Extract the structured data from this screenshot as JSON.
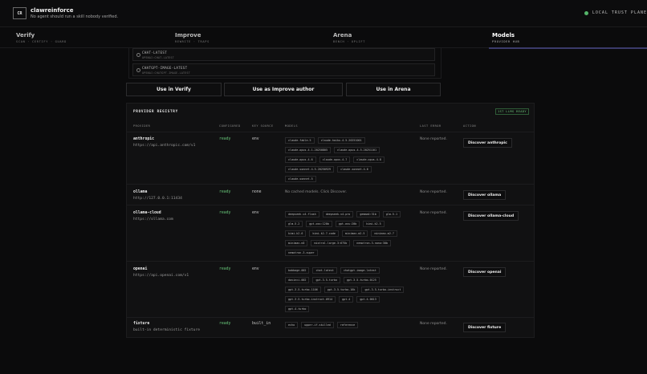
{
  "app": {
    "logo_text": "CR",
    "title": "clawreinforce",
    "tagline": "No agent should run a skill nobody verified.",
    "trust_label": "LOCAL TRUST PLANE"
  },
  "nav": {
    "tabs": [
      {
        "title": "Verify",
        "sub": "SCAN · CERTIFY · GUARD"
      },
      {
        "title": "Improve",
        "sub": "REWRITE · TRAPS"
      },
      {
        "title": "Arena",
        "sub": "BENCH · UPLIFT"
      },
      {
        "title": "Models",
        "sub": "PROVIDER HUB"
      }
    ]
  },
  "models_list": [
    {
      "name": "CHAT-LATEST",
      "id": "OPENAI:CHAT-LATEST"
    },
    {
      "name": "CHATGPT-IMAGE-LATEST",
      "id": "OPENAI:CHATGPT-IMAGE-LATEST"
    }
  ],
  "actions": {
    "use_verify": "Use in Verify",
    "use_improve": "Use as Improve author",
    "use_arena": "Use in Arena"
  },
  "registry": {
    "title": "PROVIDER REGISTRY",
    "badge": "1ST LLMS READY",
    "columns": [
      "PROVIDER",
      "CONFIGURED",
      "KEY SOURCE",
      "MODELS",
      "LAST ERROR",
      "ACTION"
    ],
    "rows": [
      {
        "name": "anthropic",
        "url": "https://api.anthropic.com/v1",
        "configured": "ready",
        "key_source": "env",
        "models": [
          "claude-fable-5",
          "claude-haiku-4-5-20251001",
          "claude-opus-4-1-20250805",
          "claude-opus-4-5-20251101",
          "claude-opus-4-6",
          "claude-opus-4-7",
          "claude-opus-4-8",
          "claude-sonnet-4-5-20250929",
          "claude-sonnet-4-6",
          "claude-sonnet-5"
        ],
        "last_error": "None reported.",
        "action": "Discover anthropic"
      },
      {
        "name": "ollama",
        "url": "http://127.0.0.1:11434",
        "configured": "ready",
        "key_source": "none",
        "models_text": "No cached models. Click Discover.",
        "last_error": "None reported.",
        "action": "Discover ollama"
      },
      {
        "name": "ollama-cloud",
        "url": "https://ollama.com",
        "configured": "ready",
        "key_source": "env",
        "models": [
          "deepseek-v4-flash",
          "deepseek-v4-pro",
          "gemma4:31b",
          "glm-5.1",
          "glm-5.2",
          "gpt-oss:120b",
          "gpt-oss:20b",
          "kimi-k2.5",
          "kimi-k2.6",
          "kimi-k2.7-code",
          "minimax-m2.5",
          "minimax-m2.7",
          "minimax-m3",
          "mistral-large-3:675b",
          "nemotron-3-nano:30b",
          "nemotron-3-super"
        ],
        "last_error": "None reported.",
        "action": "Discover ollama-cloud"
      },
      {
        "name": "openai",
        "url": "https://api.openai.com/v1",
        "configured": "ready",
        "key_source": "env",
        "models": [
          "babbage-002",
          "chat-latest",
          "chatgpt-image-latest",
          "davinci-002",
          "gpt-3.5-turbo",
          "gpt-3.5-turbo-0125",
          "gpt-3.5-turbo-1106",
          "gpt-3.5-turbo-16k",
          "gpt-3.5-turbo-instruct",
          "gpt-3.5-turbo-instruct-0914",
          "gpt-4",
          "gpt-4-0613",
          "gpt-4-turbo"
        ],
        "last_error": "None reported.",
        "action": "Discover openai"
      },
      {
        "name": "fixture",
        "url": "built-in deterministic fixture",
        "configured": "ready",
        "key_source": "built_in",
        "models": [
          "echo",
          "upper-if-skilled",
          "reference"
        ],
        "last_error": "None reported.",
        "action": "Discover fixture"
      }
    ]
  }
}
